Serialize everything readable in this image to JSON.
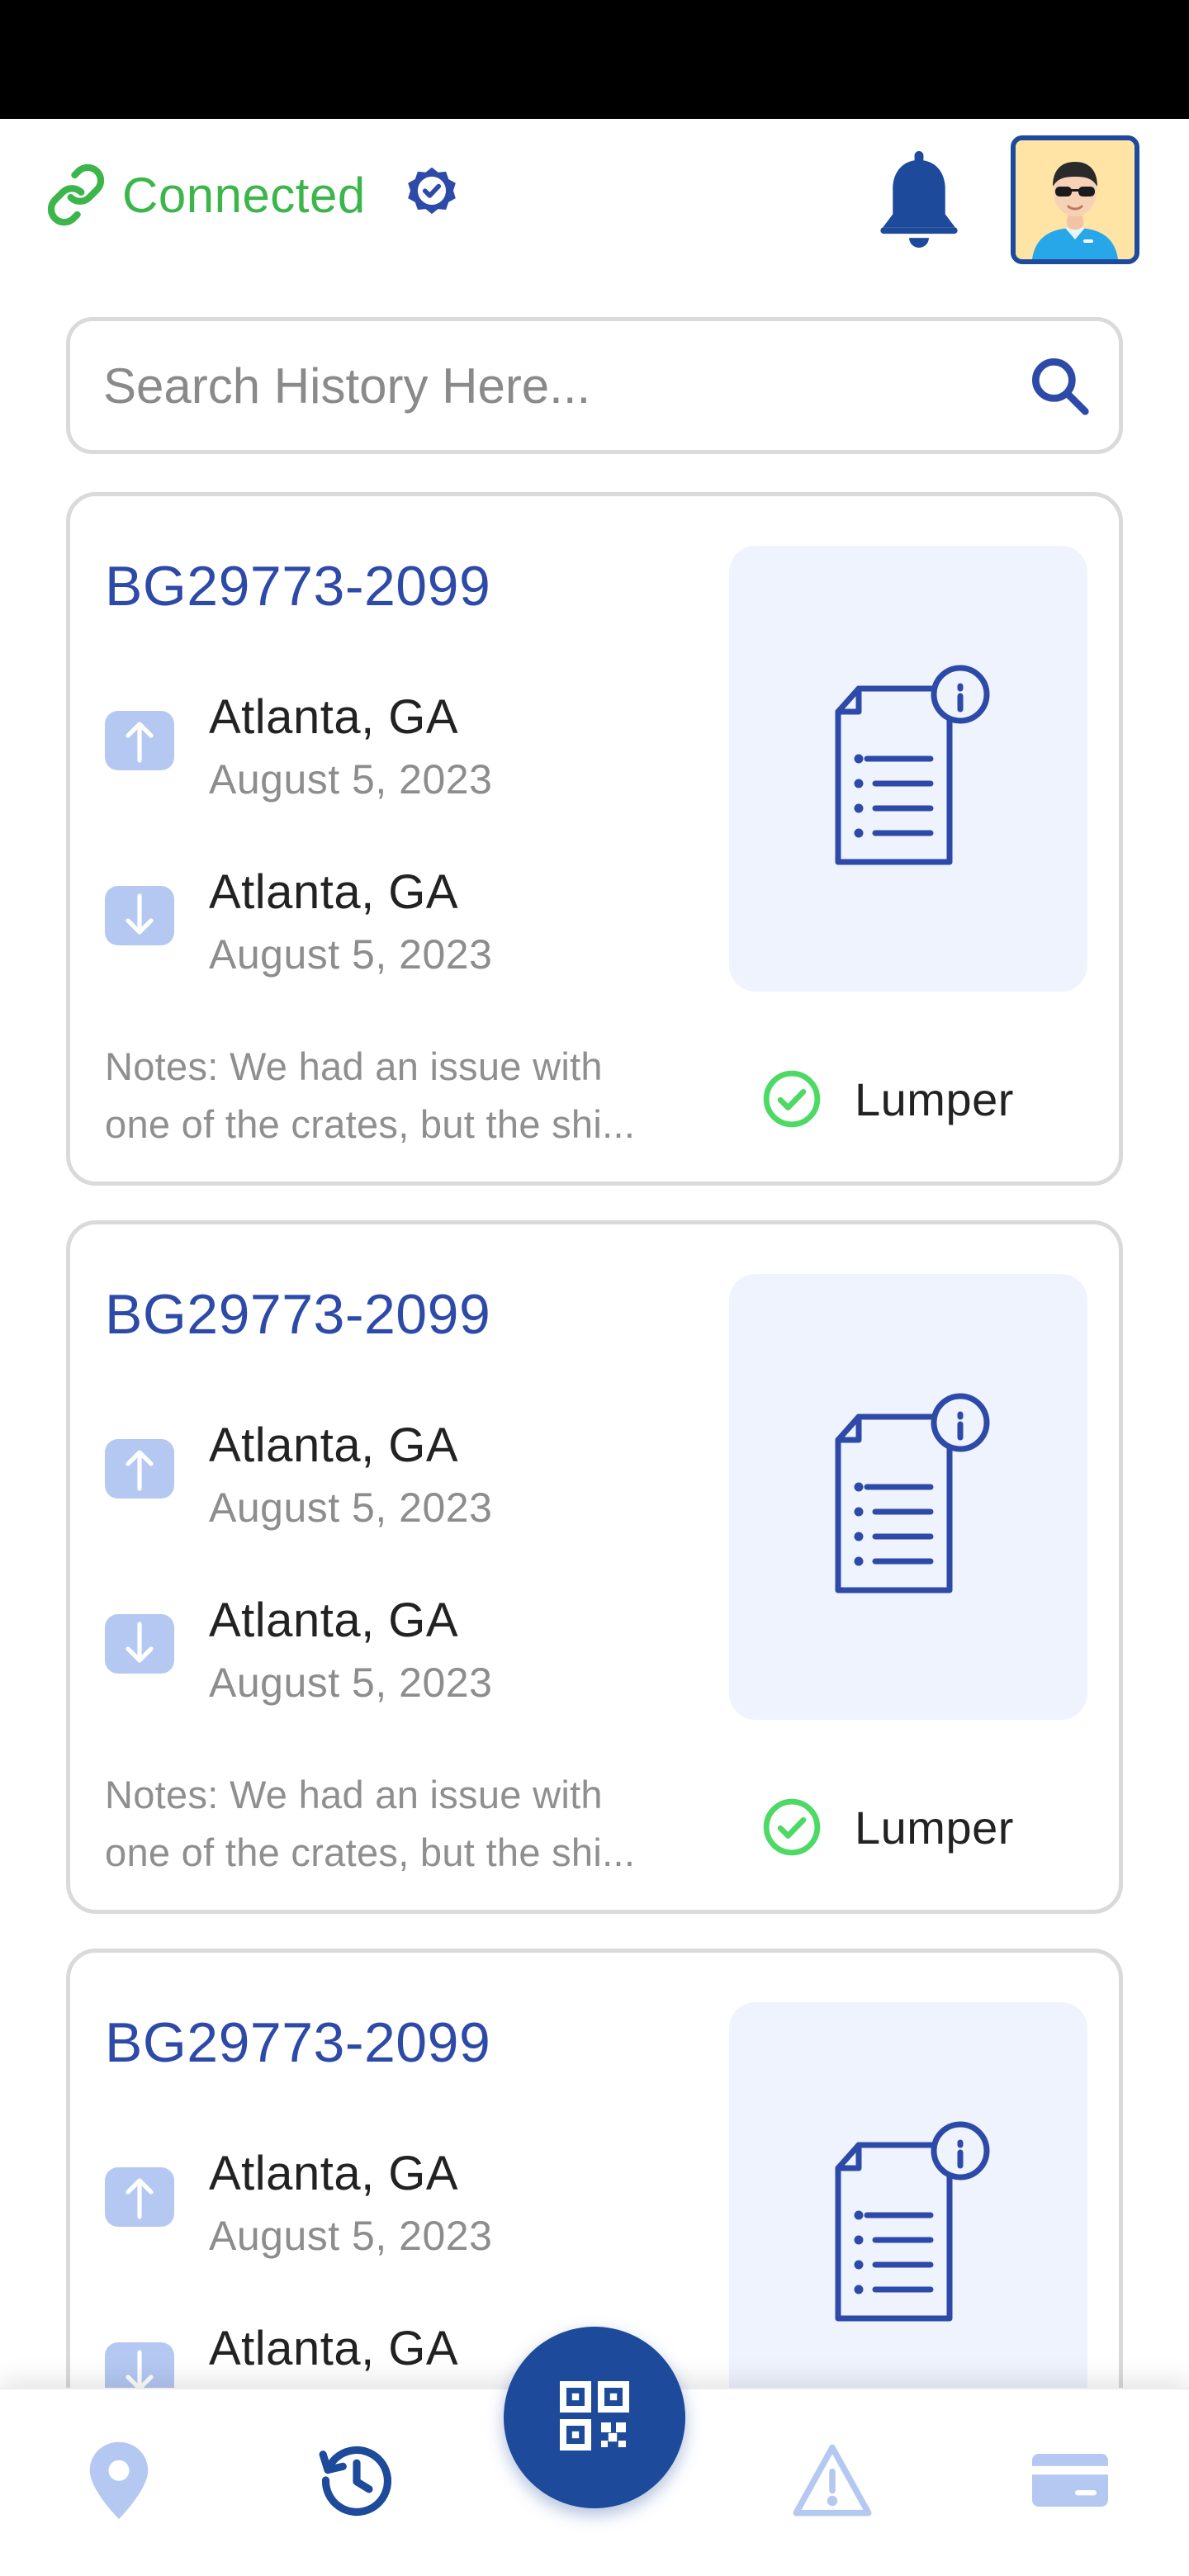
{
  "header": {
    "connection_status": "Connected",
    "icons": {
      "connection": "link-icon",
      "verified": "verified-badge-icon",
      "notifications": "bell-icon",
      "profile": "avatar"
    }
  },
  "search": {
    "placeholder": "Search History Here...",
    "value": "",
    "icon": "search-icon"
  },
  "history": [
    {
      "load_id": "BG29773-2099",
      "pickup": {
        "city": "Atlanta, GA",
        "date": "August 5, 2023"
      },
      "dropoff": {
        "city": "Atlanta, GA",
        "date": "August 5, 2023"
      },
      "notes": {
        "line1": "Notes: We had an issue with",
        "line2": "one of the crates, but the shi..."
      },
      "lumper": {
        "label": "Lumper",
        "checked": true
      }
    },
    {
      "load_id": "BG29773-2099",
      "pickup": {
        "city": "Atlanta, GA",
        "date": "August 5, 2023"
      },
      "dropoff": {
        "city": "Atlanta, GA",
        "date": "August 5, 2023"
      },
      "notes": {
        "line1": "Notes: We had an issue with",
        "line2": "one of the crates, but the shi..."
      },
      "lumper": {
        "label": "Lumper",
        "checked": true
      }
    },
    {
      "load_id": "BG29773-2099",
      "pickup": {
        "city": "Atlanta, GA",
        "date": "August 5, 2023"
      },
      "dropoff": {
        "city": "Atlanta, GA",
        "date": ""
      },
      "notes": {
        "line1": "",
        "line2": ""
      },
      "lumper": {
        "label": "",
        "checked": true
      }
    }
  ],
  "bottom_nav": {
    "items": [
      "location-pin-icon",
      "history-clock-icon",
      "qr-code-icon",
      "alert-triangle-icon",
      "card-icon"
    ],
    "active": "history-clock-icon"
  },
  "colors": {
    "accent": "#1d4a9a",
    "load_id": "#2d4aa8",
    "connected": "#3cb64a",
    "lumper_check": "#4cd964",
    "tile_bg": "#eef3fd",
    "stop_icon_bg": "#b4c8f2",
    "inactive_nav": "#b4c8f2"
  }
}
